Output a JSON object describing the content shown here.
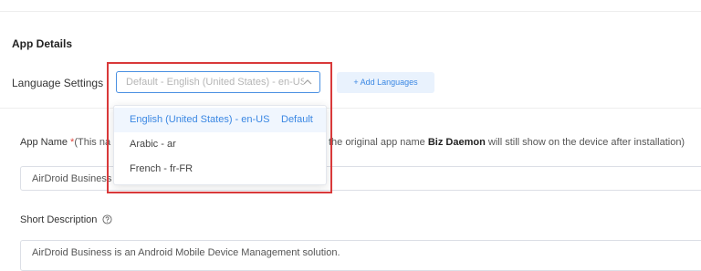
{
  "app_details": {
    "section_title": "App Details",
    "language_settings": {
      "label": "Language Settings",
      "selected_value": "Default - English (United States) - en-US",
      "add_languages_label": "+ Add Languages",
      "dropdown": {
        "options": [
          {
            "label": "English (United States) - en-US",
            "tag": "Default",
            "selected": true
          },
          {
            "label": "Arabic - ar"
          },
          {
            "label": "French - fr-FR"
          }
        ]
      }
    },
    "app_name": {
      "label": "App Name",
      "required_mark": "*",
      "hint_prefix": "(This na",
      "hint_suffix_before": "the original app name",
      "hint_app_name": "Biz Daemon",
      "hint_suffix_after": "will still show on the device after installation)",
      "value": "AirDroid Business"
    },
    "short_description": {
      "label": "Short Description",
      "help_icon": "question-circle-icon",
      "value": "AirDroid Business is an Android Mobile Device Management solution."
    }
  },
  "colors": {
    "accent": "#3a87e3",
    "highlight_border": "#d9393a",
    "required": "#e0463c"
  }
}
